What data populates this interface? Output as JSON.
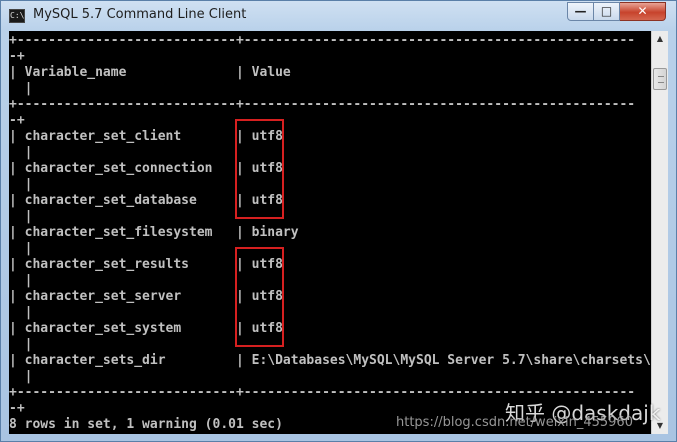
{
  "window": {
    "title": "MySQL 5.7 Command Line Client",
    "icon": "cmd-icon",
    "icon_text": "C:\\",
    "controls": {
      "minimize": "—",
      "maximize": "□",
      "close": "✕"
    }
  },
  "console": {
    "lines": [
      "+----------------------------+--------------------------------------------------",
      "-+",
      "| Variable_name              | Value",
      "  |",
      "+----------------------------+--------------------------------------------------",
      "-+",
      "| character_set_client       | utf8",
      "  |",
      "| character_set_connection   | utf8",
      "  |",
      "| character_set_database     | utf8",
      "  |",
      "| character_set_filesystem   | binary",
      "  |",
      "| character_set_results      | utf8",
      "  |",
      "| character_set_server       | utf8",
      "  |",
      "| character_set_system       | utf8",
      "  |",
      "| character_sets_dir         | E:\\Databases\\MySQL\\MySQL Server 5.7\\share\\charsets\\",
      "  |",
      "+----------------------------+--------------------------------------------------",
      "-+",
      "8 rows in set, 1 warning (0.01 sec)"
    ]
  },
  "scrollbar": {
    "up_arrow": "▲",
    "down_arrow": "▼"
  },
  "watermark": {
    "site": "知乎 @daskdajk",
    "url": "https://blog.csdn.net/weixin_455960"
  },
  "annotations": {
    "highlight_color": "#d62020"
  }
}
